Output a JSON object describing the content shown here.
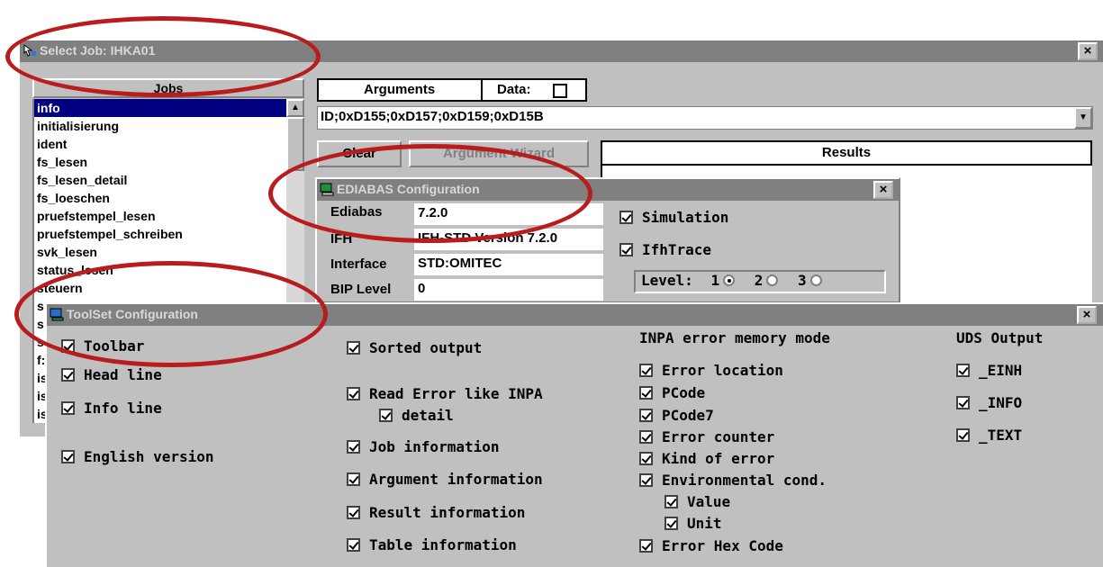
{
  "select_job": {
    "title": "Select Job: IHKA01",
    "close": "×",
    "jobs_header": "Jobs",
    "jobs": [
      "info",
      "initialisierung",
      "ident",
      "fs_lesen",
      "fs_lesen_detail",
      "fs_loeschen",
      "pruefstempel_lesen",
      "pruefstempel_schreiben",
      "svk_lesen",
      "status_lesen",
      "steuern",
      "s",
      "s",
      "s",
      "f:",
      "is",
      "is",
      "is"
    ],
    "arguments_header": "Arguments",
    "data_label": "Data:",
    "arguments_value": "ID;0xD155;0xD157;0xD159;0xD15B",
    "clear_button": "Clear",
    "argument_wizard_button": "Argument Wizard",
    "results_header": "Results"
  },
  "ediabas": {
    "title": "EDIABAS Configuration",
    "close": "×",
    "ediabas_label": "Ediabas",
    "ediabas_value": "7.2.0",
    "ifh_label": "IFH",
    "ifh_value": "IFH-STD Version 7.2.0",
    "interface_label": "Interface",
    "interface_value": "STD:OMITEC",
    "bip_label": "BIP Level",
    "bip_value": "0",
    "simulation": "Simulation",
    "ifhtrace": "IfhTrace",
    "level_label": "Level:",
    "level_options": [
      "1",
      "2",
      "3"
    ]
  },
  "toolset": {
    "title": "ToolSet Configuration",
    "close": "×",
    "col1": [
      "Toolbar",
      "Head line",
      "Info line",
      "English version"
    ],
    "col2": [
      "Sorted output",
      "Read Error like INPA",
      "detail",
      "Job information",
      "Argument information",
      "Result information",
      "Table information"
    ],
    "col3_header": "INPA error memory mode",
    "col3": [
      "Error location",
      "PCode",
      "PCode7",
      "Error counter",
      "Kind of error",
      "Environmental cond.",
      "Value",
      "Unit",
      "Error Hex Code"
    ],
    "col4_header": "UDS Output",
    "col4": [
      "_EINH",
      "_INFO",
      "_TEXT"
    ]
  },
  "colors": {
    "title_inactive": "#808080",
    "selection": "#000080",
    "highlight_ellipse": "#b81c1c",
    "face": "#c0c0c0"
  }
}
